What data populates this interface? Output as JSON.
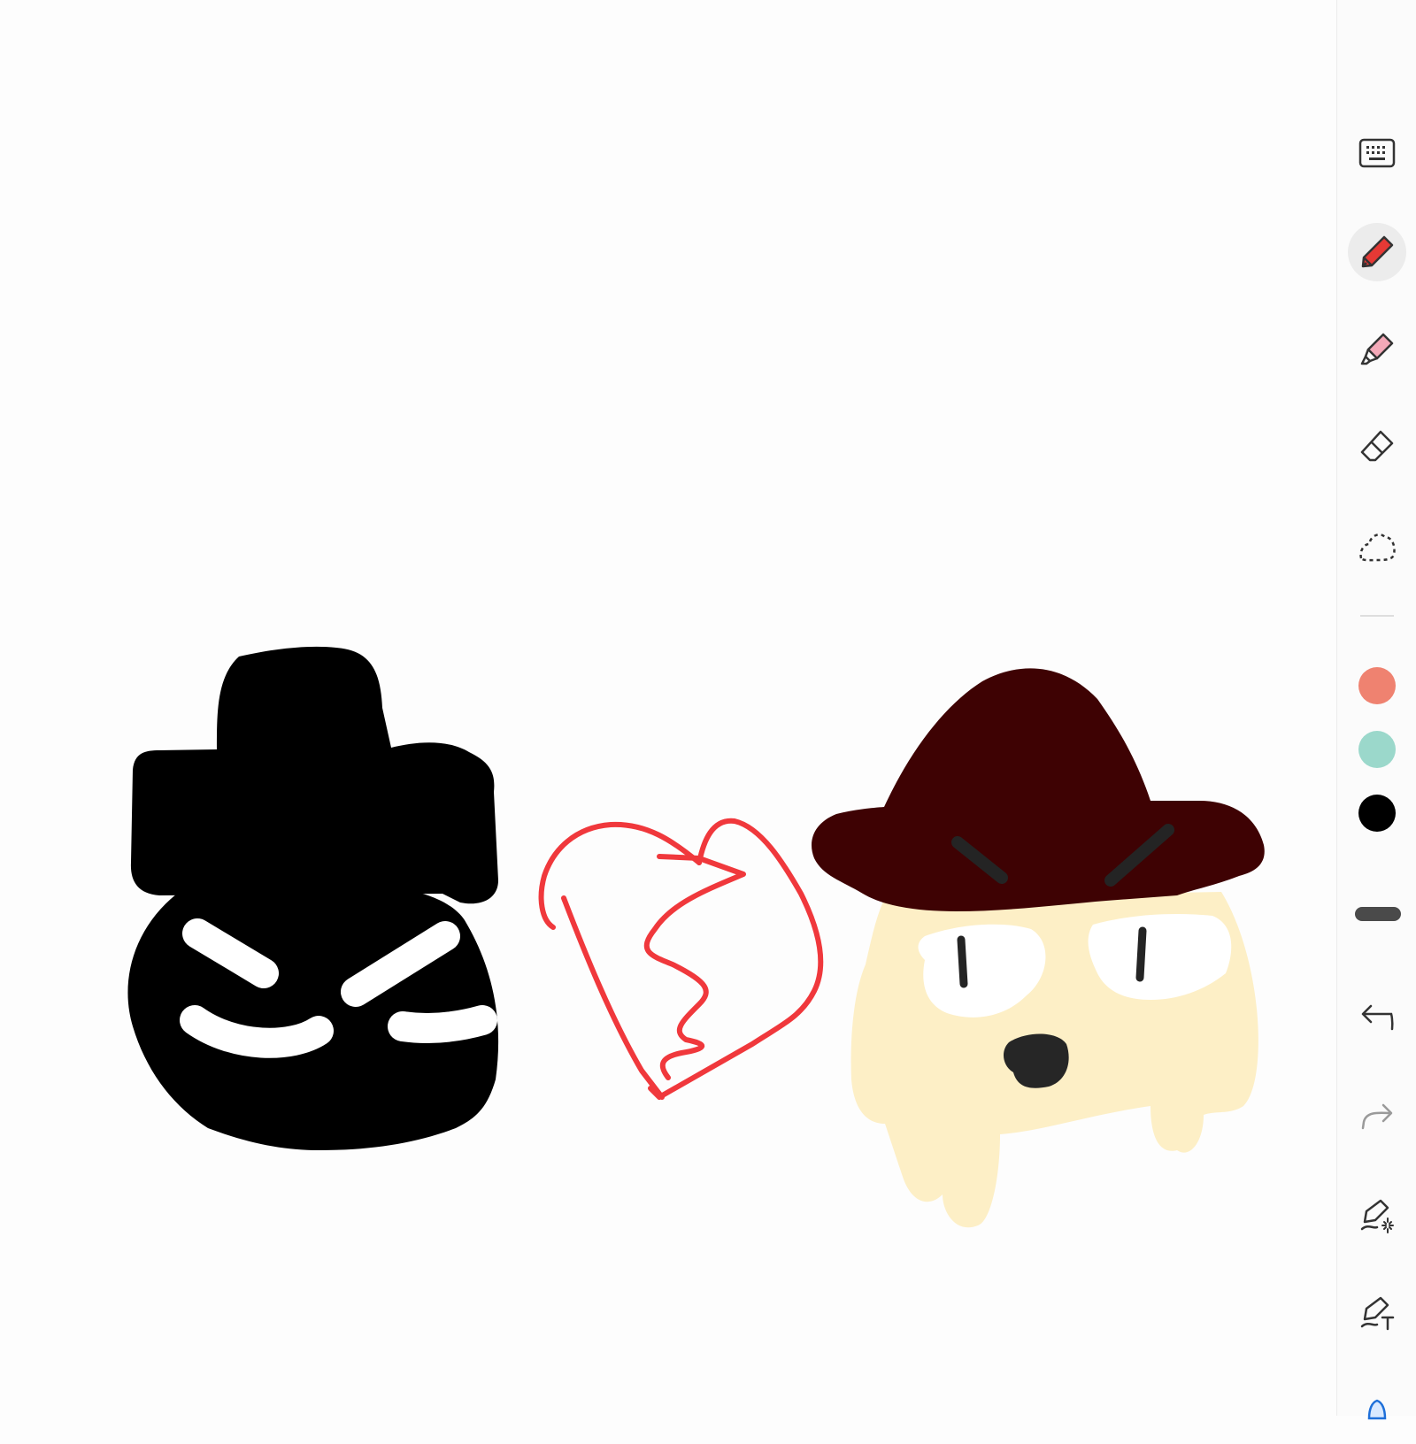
{
  "canvas": {
    "drawings": [
      {
        "name": "shadow-character",
        "colors": {
          "body": "#000000",
          "eyes": "#ffffff"
        }
      },
      {
        "name": "broken-heart",
        "colors": {
          "stroke": "#f0383c"
        }
      },
      {
        "name": "hat-character",
        "colors": {
          "hat": "#3e0203",
          "face": "#fdefc6",
          "eyes": "#ffffff",
          "nose": "#262626",
          "marks": "#242424"
        }
      }
    ]
  },
  "toolbar": {
    "tools": [
      {
        "id": "keyboard",
        "icon": "keyboard-icon",
        "active": false
      },
      {
        "id": "pen",
        "icon": "pen-icon",
        "active": true,
        "accent": "#e53935"
      },
      {
        "id": "highlighter",
        "icon": "highlighter-icon",
        "active": false,
        "accent": "#f4a9b8"
      },
      {
        "id": "eraser",
        "icon": "eraser-icon",
        "active": false
      },
      {
        "id": "lasso",
        "icon": "lasso-select-icon",
        "active": false
      }
    ],
    "colors": [
      {
        "name": "coral",
        "hex": "#ef8270"
      },
      {
        "name": "mint",
        "hex": "#9bd8cb"
      },
      {
        "name": "black",
        "hex": "#000000",
        "selected": true
      }
    ],
    "stroke_thickness": {
      "icon": "stroke-thickness-icon",
      "color": "#4a4a4a"
    },
    "actions": [
      {
        "id": "undo",
        "icon": "undo-icon",
        "enabled": true
      },
      {
        "id": "redo",
        "icon": "redo-icon",
        "enabled": false
      },
      {
        "id": "ink-effects",
        "icon": "ink-sparkle-icon"
      },
      {
        "id": "ink-to-text",
        "icon": "ink-to-text-icon"
      },
      {
        "id": "more",
        "icon": "more-tools-icon"
      }
    ]
  }
}
